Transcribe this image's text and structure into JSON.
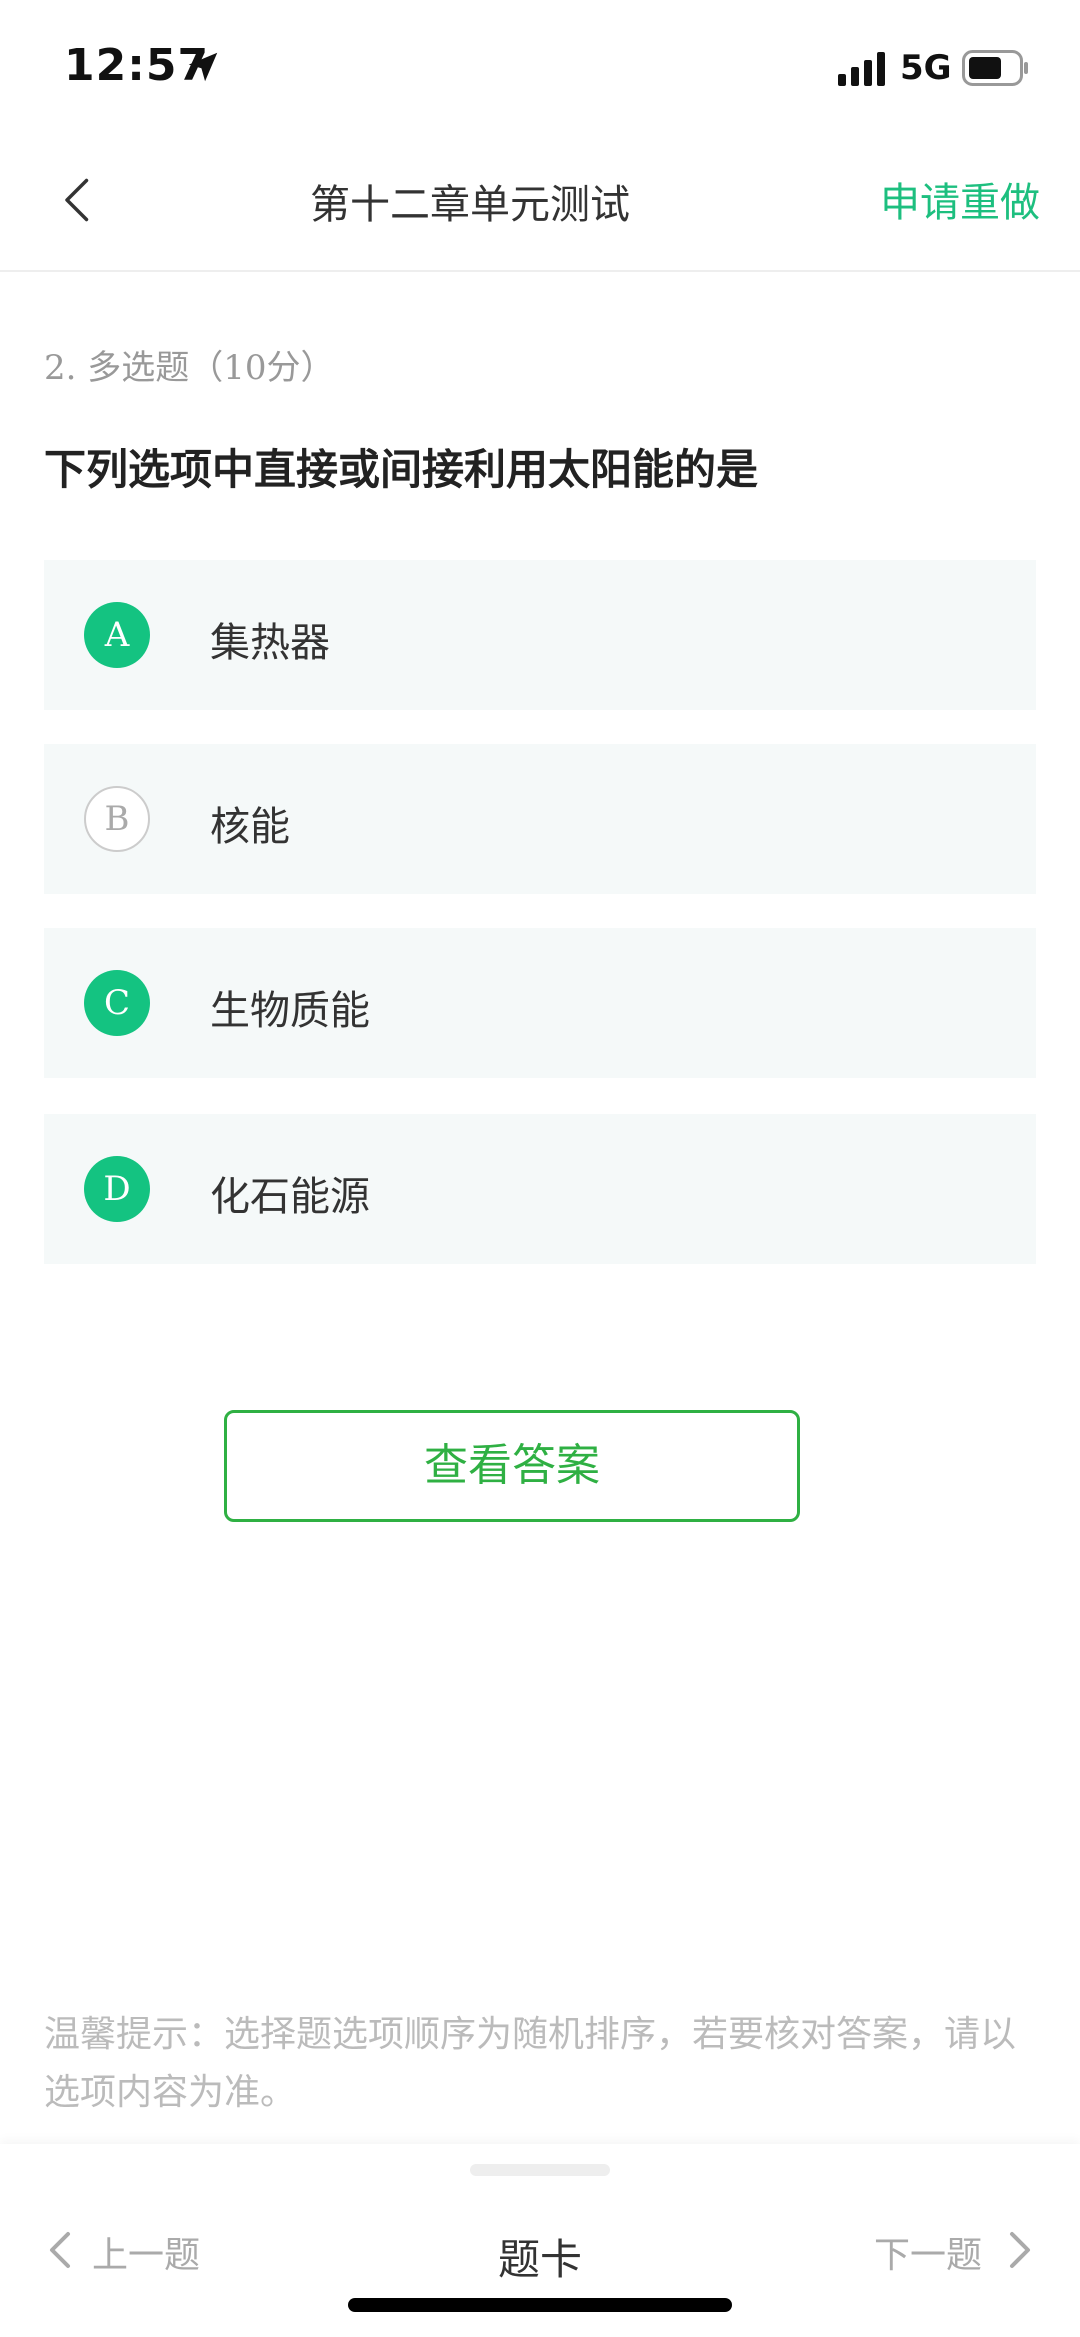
{
  "status_bar": {
    "time": "12:57",
    "network": "5G",
    "icons": [
      "location-arrow-icon",
      "signal-icon",
      "battery-icon"
    ]
  },
  "nav": {
    "back_icon": "chevron-left-icon",
    "title": "第十二章单元测试",
    "redo_label": "申请重做"
  },
  "question": {
    "type_label": "2. 多选题（10分）",
    "stem": "下列选项中直接或间接利用太阳能的是",
    "options": [
      {
        "letter": "A",
        "text": "集热器",
        "selected": true
      },
      {
        "letter": "B",
        "text": "核能",
        "selected": false
      },
      {
        "letter": "C",
        "text": "生物质能",
        "selected": true
      },
      {
        "letter": "D",
        "text": "化石能源",
        "selected": true
      }
    ]
  },
  "view_answer_label": "查看答案",
  "tip": "温馨提示：选择题选项顺序为随机排序，若要核对答案，请以选项内容为准。",
  "bottom_bar": {
    "prev_label": "上一题",
    "card_label": "题卡",
    "next_label": "下一题"
  },
  "colors": {
    "accent": "#1dbf7f",
    "selected_badge": "#14c381",
    "button_green": "#2fb043",
    "option_bg": "#f5f9f9"
  }
}
